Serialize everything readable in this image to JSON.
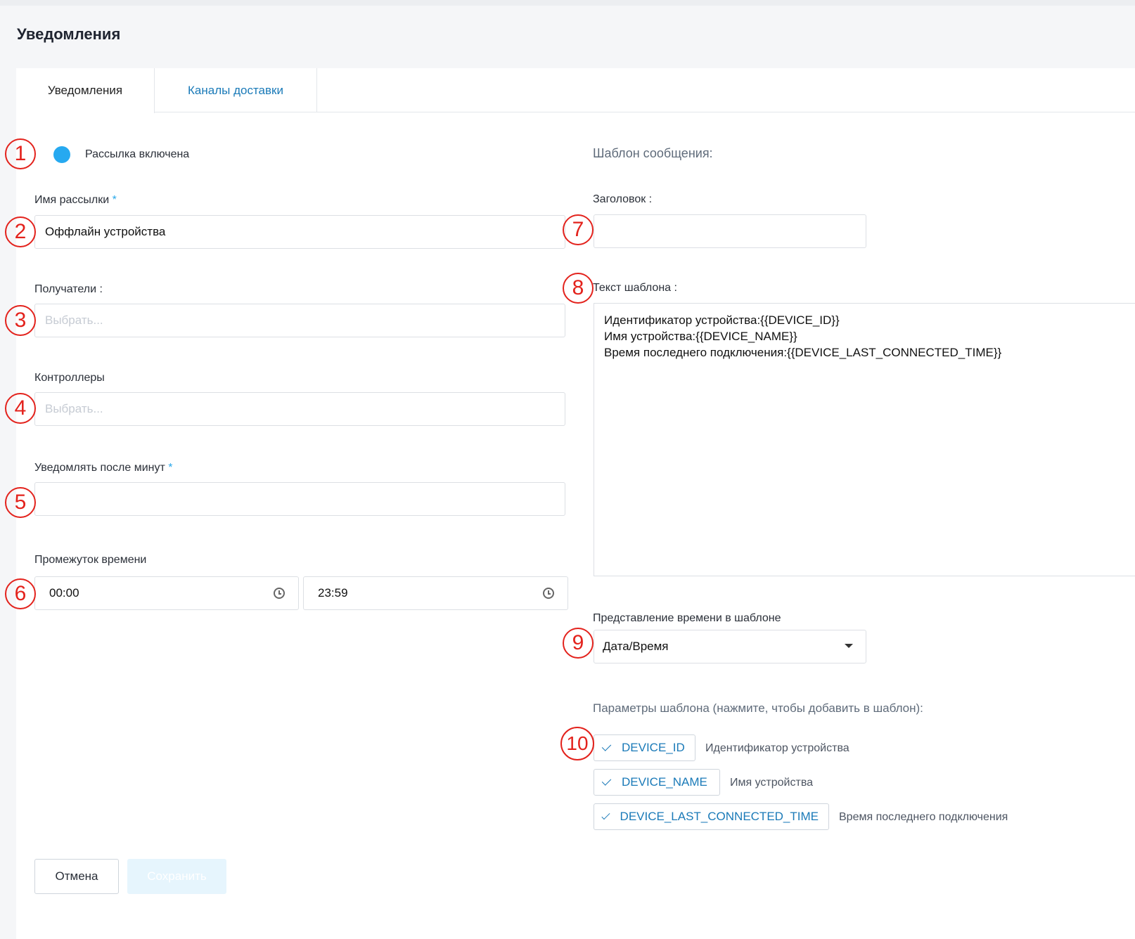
{
  "page": {
    "title": "Уведомления"
  },
  "tabs": [
    {
      "label": "Уведомления",
      "active": true
    },
    {
      "label": "Каналы доставки",
      "active": false
    }
  ],
  "markers": [
    "1",
    "2",
    "3",
    "4",
    "5",
    "6",
    "7",
    "8",
    "9",
    "10"
  ],
  "form": {
    "toggle_label": "Рассылка включена",
    "toggle_on": true,
    "name_label": "Имя рассылки",
    "name_value": "Оффлайн устройства",
    "recipients_label": "Получатели :",
    "recipients_placeholder": "Выбрать...",
    "controllers_label": "Контроллеры",
    "controllers_placeholder": "Выбрать...",
    "notify_after_label": "Уведомлять после минут",
    "notify_after_value": "",
    "time_range_label": "Промежуток времени",
    "time_from": "00:00",
    "time_to": "23:59",
    "required_mark": "*"
  },
  "template": {
    "section_title": "Шаблон сообщения:",
    "header_label": "Заголовок :",
    "header_value": "",
    "text_label": "Текст шаблона :",
    "text_lines": [
      "Идентификатор устройства:{{DEVICE_ID}}",
      "Имя устройства:{{DEVICE_NAME}}",
      "Время последнего подключения:{{DEVICE_LAST_CONNECTED_TIME}}"
    ],
    "time_format_label": "Представление времени в шаблоне",
    "time_format_value": "Дата/Время",
    "params_title": "Параметры шаблона (нажмите, чтобы добавить в шаблон):",
    "params": [
      {
        "key": "DEVICE_ID",
        "desc": "Идентификатор устройства"
      },
      {
        "key": "DEVICE_NAME",
        "desc": "Имя устройства"
      },
      {
        "key": "DEVICE_LAST_CONNECTED_TIME",
        "desc": "Время последнего подключения"
      }
    ]
  },
  "buttons": {
    "cancel": "Отмена",
    "save": "Сохранить"
  },
  "colors": {
    "accent": "#26a9f0",
    "link": "#1a7ab8",
    "marker": "#e3221c"
  }
}
